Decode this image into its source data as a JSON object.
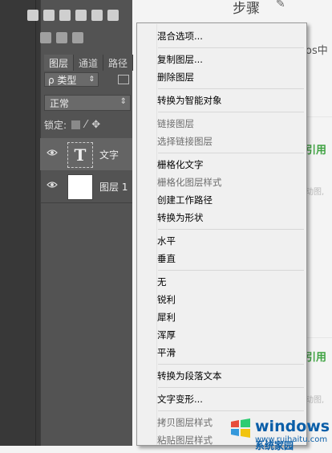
{
  "background_page": {
    "title_fragment": "步骤",
    "ps_text_fragment": "os中",
    "quote_label": "引用",
    "gif_note": "动图,"
  },
  "layers_panel": {
    "tabs": [
      {
        "label": "图层",
        "active": true
      },
      {
        "label": "通道",
        "active": false
      },
      {
        "label": "路径",
        "active": false
      }
    ],
    "filter_kind": "ρ 类型",
    "blend_mode": "正常",
    "lock_label": "锁定:",
    "layers": [
      {
        "name": "文字",
        "thumb_glyph": "T",
        "selected": true
      },
      {
        "name": "图层 1",
        "thumb_glyph": "",
        "selected": false
      }
    ]
  },
  "context_menu": {
    "items": [
      {
        "label": "混合选项...",
        "enabled": true
      },
      {
        "label": "复制图层...",
        "enabled": true
      },
      {
        "label": "删除图层",
        "enabled": true
      },
      {
        "label": "转换为智能对象",
        "enabled": true
      },
      {
        "label": "链接图层",
        "enabled": false
      },
      {
        "label": "选择链接图层",
        "enabled": false
      },
      {
        "label": "栅格化文字",
        "enabled": true
      },
      {
        "label": "栅格化图层样式",
        "enabled": false
      },
      {
        "label": "创建工作路径",
        "enabled": true
      },
      {
        "label": "转换为形状",
        "enabled": true
      },
      {
        "label": "水平",
        "enabled": true
      },
      {
        "label": "垂直",
        "enabled": true
      },
      {
        "label": "无",
        "enabled": true
      },
      {
        "label": "锐利",
        "enabled": true
      },
      {
        "label": "犀利",
        "enabled": true
      },
      {
        "label": "浑厚",
        "enabled": true
      },
      {
        "label": "平滑",
        "enabled": true
      },
      {
        "label": "转换为段落文本",
        "enabled": true
      },
      {
        "label": "文字变形...",
        "enabled": true
      },
      {
        "label": "拷贝图层样式",
        "enabled": false
      },
      {
        "label": "粘贴图层样式",
        "enabled": false
      }
    ]
  },
  "watermark": {
    "brand": "windows",
    "site": "系统家园",
    "url": "www.ruihaitu.com"
  }
}
